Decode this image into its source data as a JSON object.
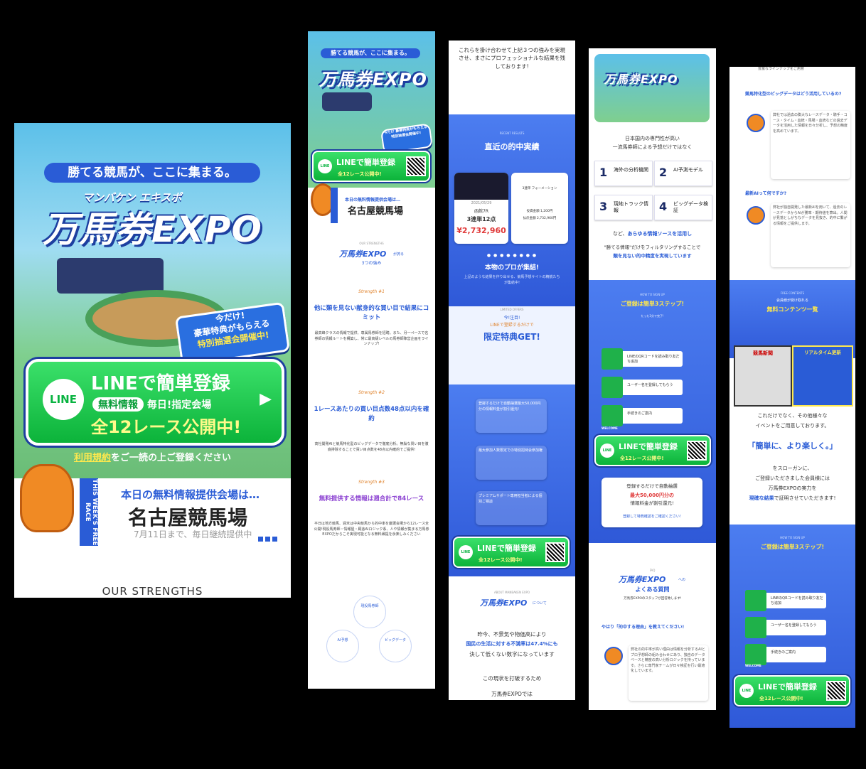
{
  "panel1": {
    "tagline": "勝てる競馬が、ここに集まる。",
    "logo_sub": "マンバケン エキスポ",
    "logo": "万馬券EXPO",
    "badge": {
      "line1": "今だけ!",
      "line2": "豪華特典がもらえる",
      "line3": "特別抽選会開催中!"
    },
    "line_button": {
      "icon": "LINE",
      "title": "LINEで簡単登録",
      "tag": "無料情報",
      "sub": "毎日!指定会場",
      "bottom": "全12レース公開中!"
    },
    "terms_link": "利用規約",
    "terms_rest": "をご一読の上ご登録ください",
    "venue": {
      "band": "THIS WEEK'S FREE RACE",
      "heading": "本日の無料情報提供会場は…",
      "name": "名古屋競馬場",
      "note": "7月11日まで、毎日継続提供中"
    },
    "section_title": "OUR STRENGTHS"
  },
  "panel2": {
    "tagline": "勝てる競馬が、ここに集まる。",
    "logo": "万馬券EXPO",
    "badge": "今だけ 豪華特典がもらえる 特別抽選会開催中!",
    "line_title": "LINEで簡単登録",
    "line_bottom": "全12レース公開中!",
    "venue_head": "本日の無料情報提供会場は…",
    "venue_name": "名古屋競馬場",
    "section_label": "OUR STRENGTHS",
    "strength_logo": "万馬券EXPO",
    "strength_logo_suffix": "が誇る",
    "strength_title": "3つの強み",
    "s1_label": "Strength #1",
    "s1_title": "他に類を見ない献身的な買い目で結果にコミット",
    "s1_body": "最高峰クラスの情報で提供、専属馬券師を招聘。また、月一ペースで名券師の情報ルートを構築し、常に最高級レベルの馬券師陣営企画をラインナップ!",
    "s2_label": "Strength #2",
    "s2_title": "1レースあたりの買い目点数48点以内を確約",
    "s2_body": "高社開発AIと競馬特化型のビッグデータで徹底分析。無駄な買い目を徹底排除することで買い目点数を48点以内確約でご提供!",
    "s3_label": "Strength #3",
    "s3_title": "無料提供する情報は週合計で84レース",
    "s3_body": "平日は地方競馬、週末は中央競馬から的中率を厳選会場から12レース全公開!現役馬券師・情報屋・厩舎AIロジック系、人や情報が集まる万馬券EXPOだからこそ実現可能となる無料縁提を余楽しみください",
    "circles": [
      "現役馬券師",
      "AI予想",
      "ビッグデータ"
    ]
  },
  "panel3": {
    "intro": "これらを掛け合わせて上記３つの強みを実現させ、まさにプロフェッショナルな結果を残しております!",
    "results_label": "RECENT RESULTS",
    "results_title": "直近の的中実績",
    "result_card": {
      "date": "2021/05/29",
      "race": "函館7R",
      "bet": "3連単12点",
      "payout": "¥2,732,960"
    },
    "result_card2": {
      "bet_type": "3連単 フォーメーション",
      "amount": "投資金額 1,200円",
      "payout": "払戻金額 2,732,960円"
    },
    "pros_title": "本物のプロが集結!",
    "pros_body": "上記のような結果を作り出せる、競馬予想サイトの精鋭たちが集結中!",
    "offers_label": "LIMITED OFFERS",
    "offers_kicker": "今!注目!",
    "offers_sub": "LINEで登録するだけで",
    "offers_title": "限定特典GET!",
    "offer1": "登録するだけで自動抽選最大50,000円分の情報料金が割引還元!",
    "offer2": "最大参加人数限定での特別招待会参加権",
    "offer3": "プレミアムサポート専用担当者による個別ご相談",
    "line_title": "LINEで簡単登録",
    "line_bottom": "全12レース公開中!",
    "about_label": "ABOUT MANBAKEN EXPO",
    "about_logo": "万馬券EXPO",
    "about_suffix": "について",
    "about_body1": "昨今、不景気や物価高により",
    "about_body2": "国民の生活に対する不満率は47.4%にも",
    "about_body3": "決して低くない数字になっています",
    "about_body4": "この現状を打破するため",
    "about_body5": "万馬券EXPOでは"
  },
  "panel4": {
    "logo": "万馬券EXPO",
    "intro1": "日本国内の専門性が高い",
    "intro2": "一流馬券師による予想だけではなく",
    "sources": [
      {
        "num": "1",
        "label": "海外の分析機関"
      },
      {
        "num": "2",
        "label": "AI予測モデル"
      },
      {
        "num": "3",
        "label": "現地トラック情報"
      },
      {
        "num": "4",
        "label": "ビッグデータ検証"
      }
    ],
    "sources_note_pre": "など、",
    "sources_note": "あらゆる情報ソースを活用し",
    "filter1": "\"勝てる情報\"だけをフィルタリングすることで",
    "filter2": "類を見ない的中精度を実現しています",
    "howto_label": "HOW TO SIGN UP",
    "howto_title": "ご登録は簡単3ステップ!",
    "howto_sub": "たった3分で完了!",
    "steps": [
      "LINEのQRコードを読み取り友だち追加",
      "ユーザー名を登録してもらう",
      "手続きのご案内"
    ],
    "welcome": "WELCOME",
    "line_title": "LINEで簡単登録",
    "line_bottom": "全12レース公開中!",
    "bonus1": "登録するだけで自動抽選",
    "bonus2": "最大50,000円分の",
    "bonus3": "情報料金が割引還元!",
    "bonus_more": "登録して特典確認をご確認ください!",
    "faq_label": "FAQ",
    "faq_logo": "万馬券EXPO",
    "faq_suffix": "への",
    "faq_title": "よくある質問",
    "faq_sub": "万馬券EXPOのスタッフが回答致します!",
    "q1": "やはり「的中する理由」を教えてください!",
    "a1": "弊社の的中率が高い理由は情報を分析するAIとプロ予想師の組み合わせにあり、独自のデータベースと精度の高い分析ロジックを持っています。さらに専門家チームが日々検証を行い最適化しています。"
  },
  "panel5": {
    "top": "豊富なラインナップをご用意",
    "q2": "競馬特化型のビッグデータはどう活用しているの?",
    "a2": "弊社では過去の膨大なレースデータ・騎手・コース・タイム・血統・馬場・血統などの過去データを活用した情報を日々分析し、予想の精度を高めています。",
    "q3": "最新AIって何ですか?",
    "a3": "弊社が独自開発した最新AIを用いて、過去のレースデータからAIが勝率・期待値を算出。人間が見落としがちなデータを見抜き、的中に繋がる情報をご提供します。",
    "free_label": "FREE CONTENTS",
    "free_pre": "会員様が受け取れる",
    "free_title": "無料コンテンツ一覧",
    "free_book": "競馬新聞",
    "free_rt": "リアルタイム更新",
    "more1": "これだけでなく、その他様々な",
    "more2": "イベントをご用意しております。",
    "slogan": "「簡単に、より楽しく。」",
    "slogan1": "をスローガンに、",
    "slogan2": "ご登録いただきました会員様には",
    "slogan3": "万馬券EXPOの実力を",
    "slogan4_em": "現確な結果",
    "slogan4": "で証明させていただきます!",
    "howto_label": "HOW TO SIGN UP",
    "howto_title": "ご登録は簡単3ステップ!",
    "steps": [
      "LINEのQRコードを読み取り友だち追加",
      "ユーザー名を登録してもらう",
      "手続きのご案内"
    ],
    "welcome": "WELCOME",
    "line_title": "LINEで簡単登録",
    "line_bottom": "全12レース公開中!"
  },
  "colors": {
    "brand_blue": "#2a5cd6",
    "line_green": "#0cb33a",
    "accent_yellow": "#ffe94d",
    "mascot_orange": "#f08a24"
  }
}
